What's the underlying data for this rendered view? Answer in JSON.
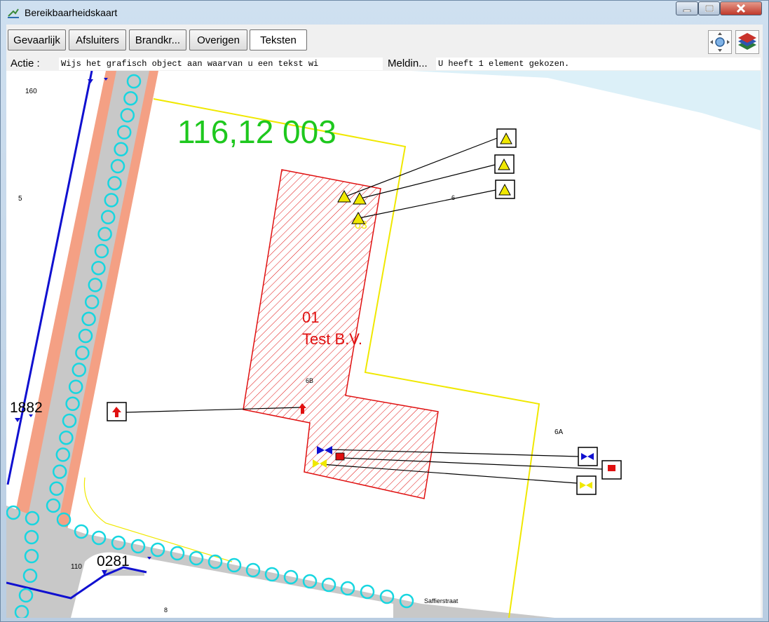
{
  "window": {
    "title": "Bereikbaarheidskaart"
  },
  "tabs": [
    {
      "label": "Gevaarlijk"
    },
    {
      "label": "Afsluiters"
    },
    {
      "label": "Brandkr..."
    },
    {
      "label": "Overigen"
    },
    {
      "label": "Teksten"
    }
  ],
  "toolbar": {
    "icons": [
      "pan-zoom-icon",
      "layers-icon"
    ]
  },
  "info": {
    "actie_label": "Actie :",
    "actie_value": "Wijs het grafisch object aan waarvan u een tekst wi",
    "melding_label": "Meldin...",
    "melding_value": "U heeft 1 element gekozen."
  },
  "map": {
    "big_label": "116,12 003",
    "building_number": "01",
    "building_name": "Test B.V.",
    "hazard_code": "03",
    "house_numbers": {
      "n160": "160",
      "n5": "5",
      "n6": "6",
      "n6b": "6B",
      "n6a": "6A",
      "n110": "110",
      "n8": "8"
    },
    "hydrants": {
      "h1882": "1882",
      "h0281": "0281"
    },
    "street": "Saffierstraat",
    "colors": {
      "building": "#e01010",
      "parcel": "#f0e800",
      "pipe": "#1010d0",
      "hydrant_ring": "#17d6e0",
      "road": "#c8c8c8",
      "water": "#dcf0f8",
      "label_green": "#1ec81e"
    }
  }
}
